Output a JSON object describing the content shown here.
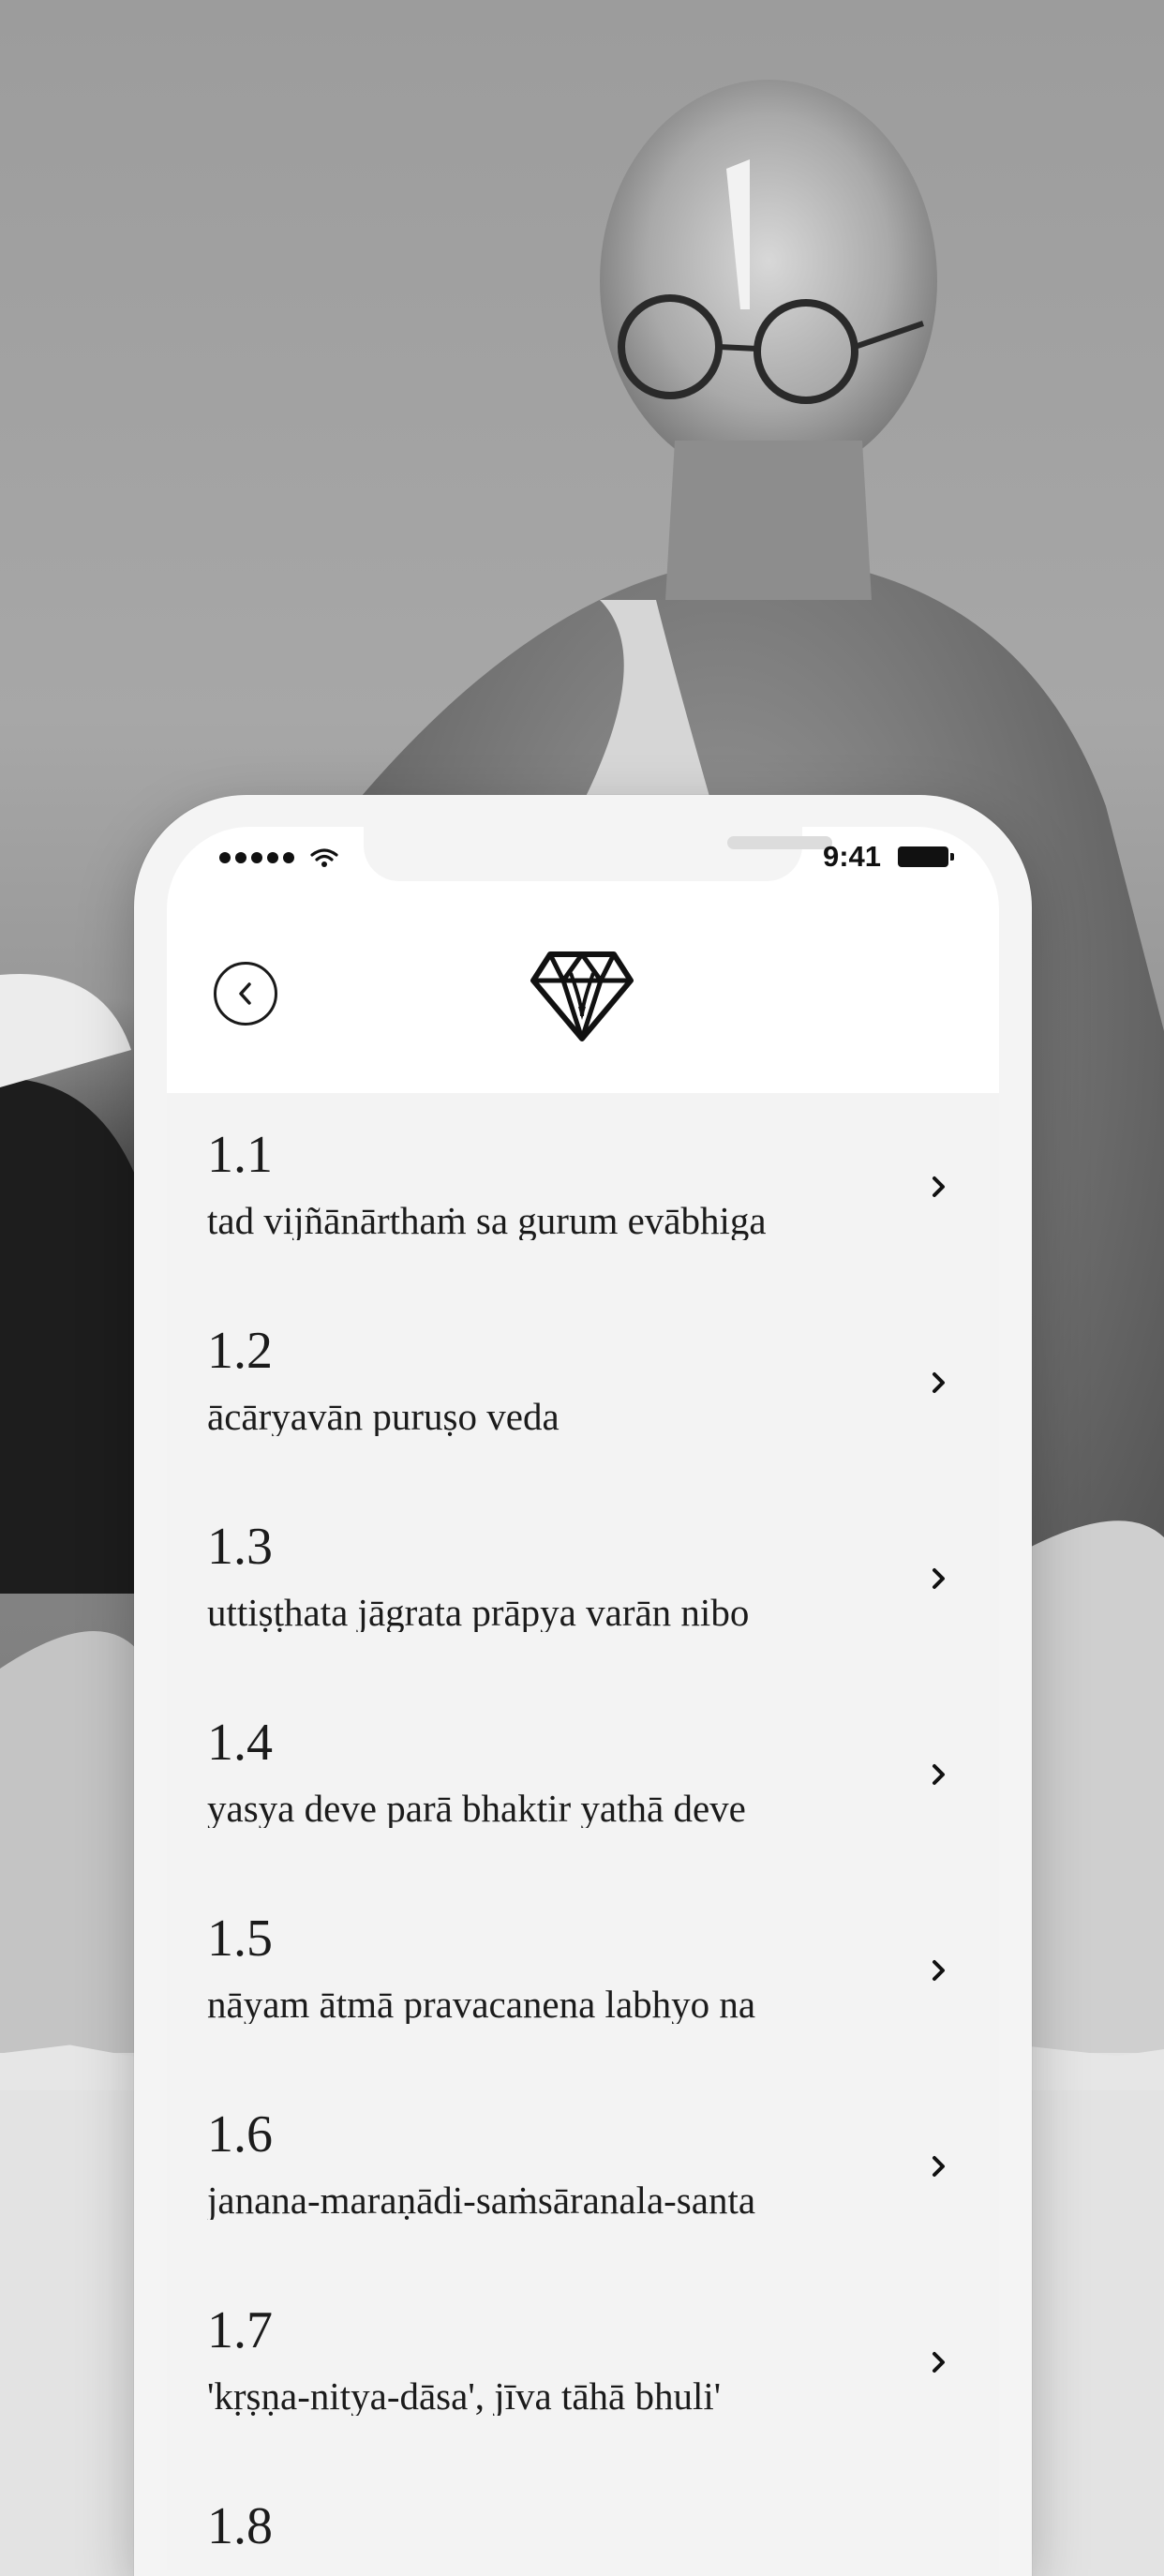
{
  "status_bar": {
    "time": "9:41",
    "icons": [
      "signal-dots-icon",
      "wifi-icon",
      "battery-icon"
    ]
  },
  "header": {
    "back_icon": "chevron-left-icon",
    "logo_icon": "diamond-logo-icon"
  },
  "verses": [
    {
      "number": "1.1",
      "text": "tad vijñānārthaṁ sa gurum evābhiga"
    },
    {
      "number": "1.2",
      "text": "ācāryavān puruṣo veda"
    },
    {
      "number": "1.3",
      "text": "uttiṣṭhata jāgrata prāpya varān nibo"
    },
    {
      "number": "1.4",
      "text": "yasya deve parā bhaktir yathā deve"
    },
    {
      "number": "1.5",
      "text": "nāyam ātmā pravacanena labhyo na"
    },
    {
      "number": "1.6",
      "text": "janana-maraṇādi-saṁsāranala-santa"
    },
    {
      "number": "1.7",
      "text": "'kṛṣṇa-nitya-dāsa', jīva tāhā bhuli'"
    },
    {
      "number": "1.8",
      "text": ""
    }
  ],
  "colors": {
    "list_bg": "#f3f3f3",
    "text": "#1b1b1b",
    "screen_bg": "#ffffff"
  }
}
